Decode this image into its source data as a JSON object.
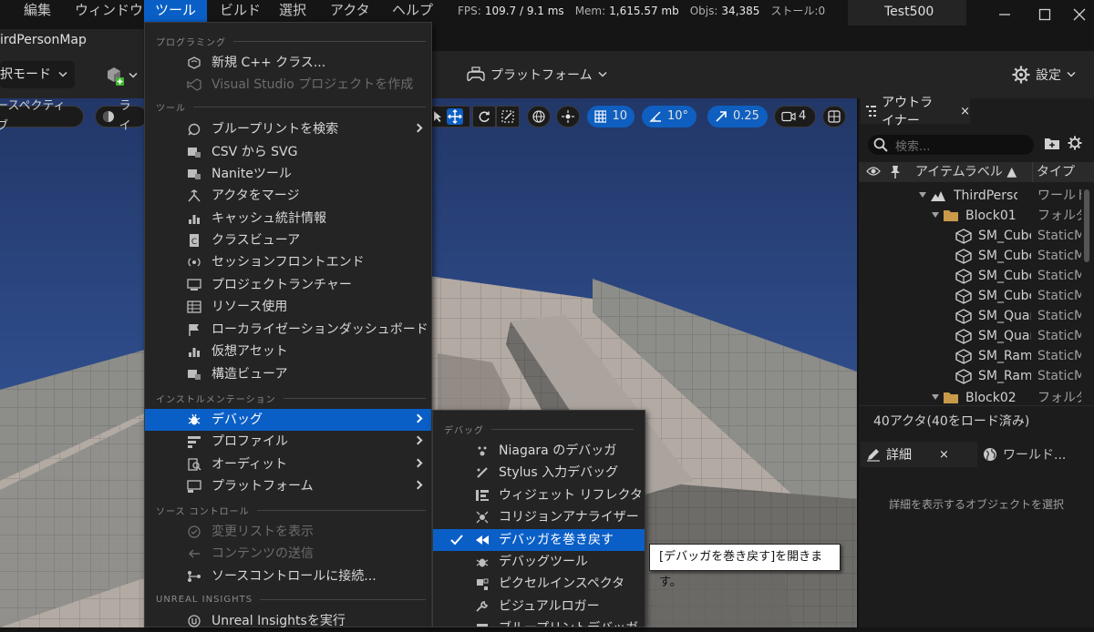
{
  "menubar": {
    "items": [
      "編集",
      "ウィンドウ",
      "ツール",
      "ビルド",
      "選択",
      "アクタ",
      "ヘルプ"
    ],
    "active_index": 2
  },
  "perf": {
    "fps_label": "FPS:",
    "fps_value": "109.7 / 9.1 ms",
    "mem_label": "Mem:",
    "mem_value": "1,615.57 mb",
    "objs_label": "Objs:",
    "objs_value": "34,385",
    "stall_label": "ストール:0"
  },
  "project_name": "Test500",
  "map_tab": "irdPersonMap",
  "toolbar": {
    "mode_label": "択モード",
    "platform_label": "プラットフォーム",
    "settings_label": "設定"
  },
  "viewport_toolbar": {
    "perspective_label": "ースペクティブ",
    "lit_label": "ライ",
    "grid_snap": "10",
    "rotation_snap": "10°",
    "scale_snap": "0.25",
    "camera_speed": "4"
  },
  "tools_menu": {
    "sections": {
      "programming": "プログラミング",
      "tools": "ツール",
      "instrumentation": "インストルメンテーション",
      "source_control": "ソース コントロール",
      "insights": "UNREAL INSIGHTS"
    },
    "items": {
      "new_cpp_class": "新規 C++ クラス...",
      "vs_project": "Visual Studio プロジェクトを作成",
      "find_blueprints": "ブループリントを検索",
      "csv_to_svg": "CSV から SVG",
      "nanite_tools": "Naniteツール",
      "merge_actors": "アクタをマージ",
      "cache_stats": "キャッシュ統計情報",
      "class_viewer": "クラスビューア",
      "session_frontend": "セッションフロントエンド",
      "project_launcher": "プロジェクトランチャー",
      "resource_usage": "リソース使用",
      "localization_dashboard": "ローカライゼーションダッシュボード",
      "virtual_assets": "仮想アセット",
      "struct_viewer": "構造ビューア",
      "debug": "デバッグ",
      "profile": "プロファイル",
      "audit": "オーディット",
      "platform": "プラットフォーム",
      "view_changelists": "変更リストを表示",
      "submit_content": "コンテンツの送信",
      "connect_source_control": "ソースコントロールに接続...",
      "run_insights": "Unreal Insightsを実行"
    }
  },
  "debug_menu": {
    "section": "デバッグ",
    "items": {
      "niagara_debugger": "Niagara のデバッガ",
      "stylus_debug": "Stylus 入力デバッグ",
      "widget_reflector": "ウィジェット リフレクタ",
      "collision_analyzer": "コリジョンアナライザー",
      "rewind_debugger": "デバッガを巻き戻す",
      "debug_tools": "デバッグツール",
      "pixel_inspector": "ピクセルインスペクタ",
      "visual_logger": "ビジュアルロガー",
      "blueprint_debugger": "ブループリントデバッガ"
    }
  },
  "tooltip": "[デバッガを巻き戻す]を開きます。",
  "outliner": {
    "tab_label": "アウトライナー",
    "close": "×",
    "search_placeholder": "検索...",
    "col_label": "アイテムラベル ▲",
    "col_type": "タイプ",
    "rows": [
      {
        "label": "ThirdPersonMap",
        "type": "ワールド"
      },
      {
        "label": "Block01",
        "type": "フォルダ"
      },
      {
        "label": "SM_Cube",
        "type": "StaticMesh"
      },
      {
        "label": "SM_Cube",
        "type": "StaticMesh"
      },
      {
        "label": "SM_Cube",
        "type": "StaticMesh"
      },
      {
        "label": "SM_Cube",
        "type": "StaticMesh"
      },
      {
        "label": "SM_QuarterCylinder",
        "type": "StaticMesh"
      },
      {
        "label": "SM_QuarterCylinder",
        "type": "StaticMesh"
      },
      {
        "label": "SM_Ramp",
        "type": "StaticMesh"
      },
      {
        "label": "SM_Ramp",
        "type": "StaticMesh"
      },
      {
        "label": "Block02",
        "type": "フォルダ"
      }
    ],
    "count": "40アクタ(40をロード済み)"
  },
  "details": {
    "tab_label": "詳細",
    "close": "×",
    "world_tab_label": "ワールド...",
    "empty_text": "詳細を表示するオブジェクトを選択"
  },
  "colors": {
    "accent": "#0a5fc7",
    "panel": "#242424",
    "sky": "#263a6c"
  }
}
